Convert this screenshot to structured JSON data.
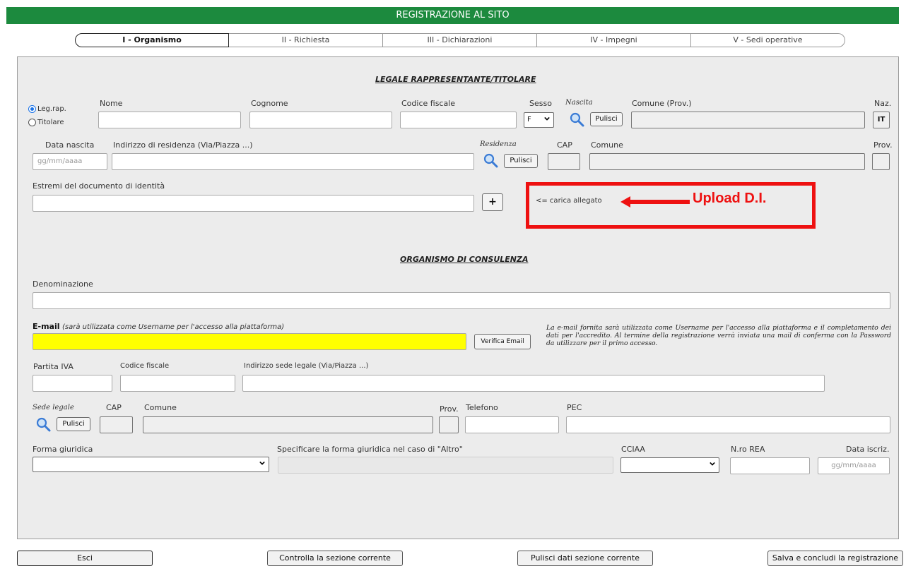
{
  "header": {
    "title": "REGISTRAZIONE AL SITO",
    "color": "#1c8a3e"
  },
  "tabs": [
    {
      "label": "I - Organismo"
    },
    {
      "label": "II - Richiesta"
    },
    {
      "label": "III - Dichiarazioni"
    },
    {
      "label": "IV - Impegni"
    },
    {
      "label": "V - Sedi operative"
    }
  ],
  "legale": {
    "section_title": "LEGALE RAPPRESENTANTE/TITOLARE",
    "radio_legrap": "Leg.rap.",
    "radio_titolare": "Titolare",
    "nome_label": "Nome",
    "cognome_label": "Cognome",
    "cf_label": "Codice fiscale",
    "sesso_label": "Sesso",
    "sesso_value": "F",
    "nascita_label": "Nascita",
    "pulisci": "Pulisci",
    "comune_prov_label": "Comune (Prov.)",
    "naz_label": "Naz.",
    "naz_value": "IT",
    "data_nascita_label": "Data nascita",
    "data_placeholder": "gg/mm/aaaa",
    "indirizzo_label": "Indirizzo di residenza (Via/Piazza ...)",
    "residenza_label": "Residenza",
    "cap_label": "CAP",
    "comune_label": "Comune",
    "prov_label": "Prov.",
    "documento_label": "Estremi del documento di identità",
    "add_button": "+",
    "allegato_text": "<= carica allegato",
    "upload_annotation": "Upload D.I."
  },
  "organismo": {
    "section_title": "ORGANISMO DI CONSULENZA",
    "denominazione_label": "Denominazione",
    "email_label": "E-mail",
    "email_note": "(sarà utilizzata come Username per l'accesso alla piattaforma)",
    "verifica_email": "Verifica Email",
    "email_info": "La e-mail fornita sarà utilizzata come Username per l'accesso alla piattaforma e il completamento dei dati per l'accredito. Al termine della registrazione verrà inviata una mail di conferma con la Password da utilizzare per il primo accesso.",
    "piva_label": "Partita IVA",
    "cf_label": "Codice fiscale",
    "indirizzo_label": "Indirizzo sede legale (Via/Piazza ...)",
    "sede_legale_label": "Sede legale",
    "pulisci": "Pulisci",
    "cap_label": "CAP",
    "comune_label": "Comune",
    "prov_label": "Prov.",
    "telefono_label": "Telefono",
    "pec_label": "PEC",
    "forma_label": "Forma giuridica",
    "altro_label": "Specificare la forma giuridica nel caso di \"Altro\"",
    "cciaa_label": "CCIAA",
    "rea_label": "N.ro REA",
    "data_iscriz_label": "Data iscriz.",
    "data_placeholder": "gg/mm/aaaa"
  },
  "footer": {
    "esci": "Esci",
    "controlla": "Controlla la sezione corrente",
    "pulisci": "Pulisci dati sezione corrente",
    "salva": "Salva e concludi la registrazione"
  },
  "colors": {
    "email_bg": "#ffff00",
    "annotation_red": "#ee1111"
  }
}
